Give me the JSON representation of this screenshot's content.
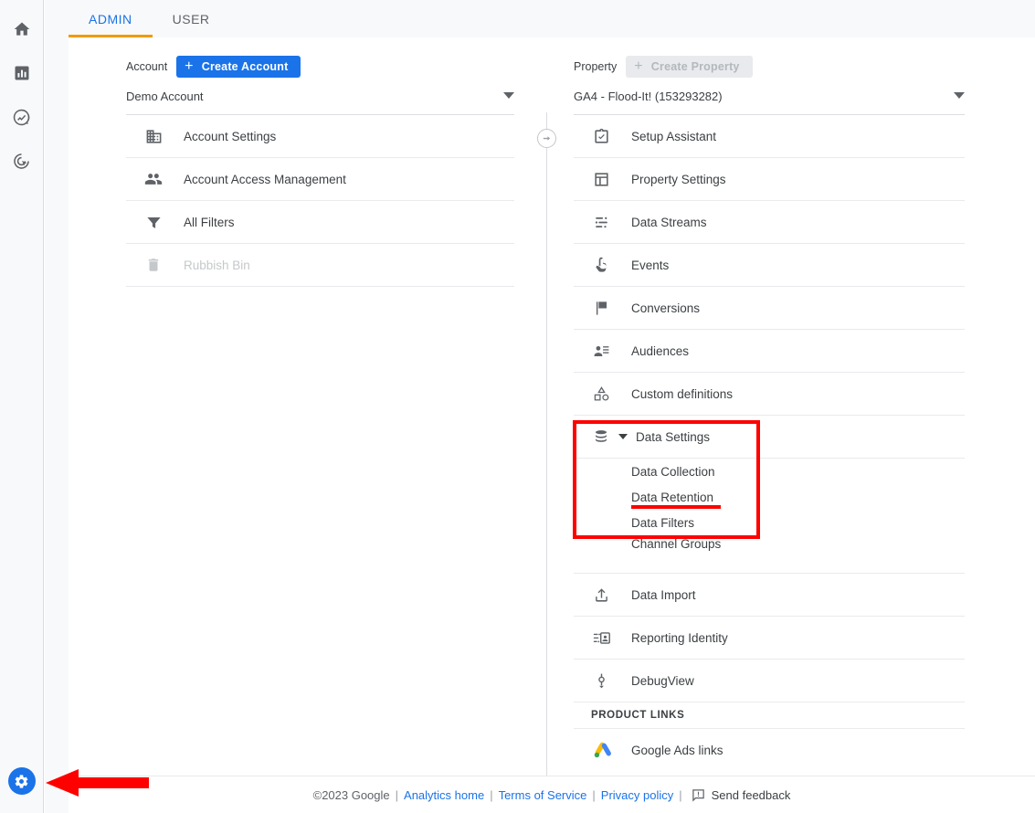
{
  "rail": {
    "items": [
      {
        "icon": "home-icon",
        "name": "home"
      },
      {
        "icon": "reports-icon",
        "name": "reports"
      },
      {
        "icon": "explore-icon",
        "name": "explore"
      },
      {
        "icon": "advertising-icon",
        "name": "advertising"
      }
    ],
    "settings_icon": "gear-icon"
  },
  "tabs": [
    {
      "label": "ADMIN",
      "active": true
    },
    {
      "label": "USER",
      "active": false
    }
  ],
  "account": {
    "header_label": "Account",
    "create_button": "Create Account",
    "selected": "Demo Account",
    "items": [
      {
        "label": "Account Settings",
        "icon": "building-icon",
        "disabled": false
      },
      {
        "label": "Account Access Management",
        "icon": "people-icon",
        "disabled": false
      },
      {
        "label": "All Filters",
        "icon": "filter-icon",
        "disabled": false
      },
      {
        "label": "Rubbish Bin",
        "icon": "trash-icon",
        "disabled": true
      }
    ]
  },
  "property": {
    "header_label": "Property",
    "create_button": "Create Property",
    "create_button_disabled": true,
    "selected": "GA4 - Flood-It! (153293282)",
    "items_top": [
      {
        "label": "Setup Assistant",
        "icon": "clipboard-check-icon"
      },
      {
        "label": "Property Settings",
        "icon": "layout-icon"
      },
      {
        "label": "Data Streams",
        "icon": "data-streams-icon"
      },
      {
        "label": "Events",
        "icon": "tap-icon"
      },
      {
        "label": "Conversions",
        "icon": "flag-icon"
      },
      {
        "label": "Audiences",
        "icon": "audience-icon"
      },
      {
        "label": "Custom definitions",
        "icon": "shapes-icon"
      }
    ],
    "data_settings": {
      "label": "Data Settings",
      "icon": "database-icon",
      "expanded": true,
      "sub_items": [
        {
          "label": "Data Collection",
          "highlighted": false
        },
        {
          "label": "Data Retention",
          "highlighted": true
        },
        {
          "label": "Data Filters",
          "highlighted": false
        },
        {
          "label": "Channel Groups",
          "highlighted": false
        }
      ]
    },
    "items_bottom": [
      {
        "label": "Data Import",
        "icon": "upload-icon"
      },
      {
        "label": "Reporting Identity",
        "icon": "identity-icon"
      },
      {
        "label": "DebugView",
        "icon": "debug-icon"
      }
    ],
    "product_links_title": "PRODUCT LINKS",
    "product_links": [
      {
        "label": "Google Ads links",
        "icon": "google-ads-icon"
      }
    ]
  },
  "footer": {
    "copyright": "©2023 Google",
    "links": [
      {
        "label": "Analytics home"
      },
      {
        "label": "Terms of Service"
      },
      {
        "label": "Privacy policy"
      }
    ],
    "feedback_label": "Send feedback",
    "separator": "|"
  },
  "annotations": {
    "box_color": "#ff0000",
    "underline_color": "#ff0000",
    "arrow_color": "#ff0000",
    "box_target": "Data Settings",
    "arrow_target": "gear-icon"
  },
  "colors": {
    "accent_blue": "#1a73e8",
    "tab_underline": "#f29900",
    "icon_grey": "#5f6368",
    "text_dark": "#3c4043",
    "rail_bg": "#f8f9fa"
  }
}
